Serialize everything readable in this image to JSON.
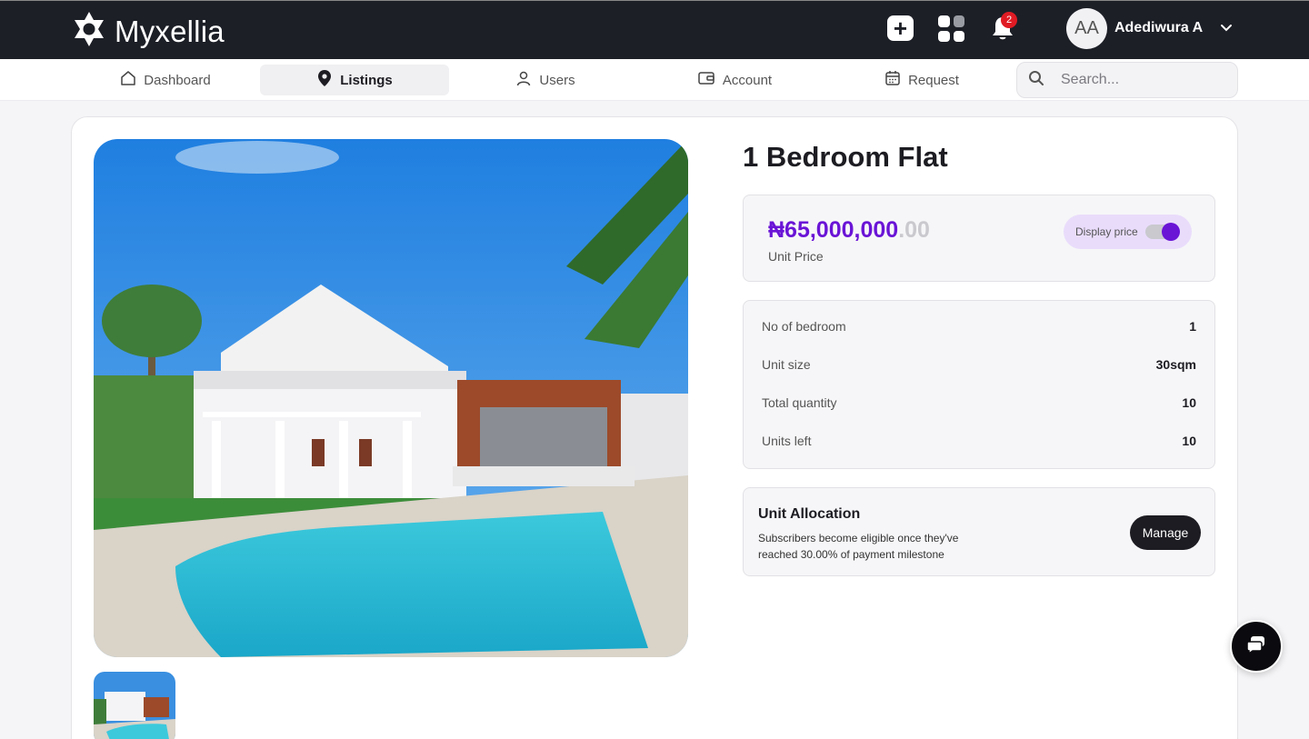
{
  "app": {
    "name": "Myxellia",
    "logo_icon": "star-logo-icon"
  },
  "topbar": {
    "notifications_count": "2",
    "user": {
      "initials": "AA",
      "name": "Adediwura A"
    }
  },
  "nav": {
    "items": [
      {
        "label": "Dashboard",
        "icon": "home-icon"
      },
      {
        "label": "Listings",
        "icon": "location-pin-icon",
        "active": true
      },
      {
        "label": "Users",
        "icon": "user-icon"
      },
      {
        "label": "Account",
        "icon": "wallet-icon"
      },
      {
        "label": "Request",
        "icon": "calendar-icon"
      }
    ],
    "search_placeholder": "Search..."
  },
  "listing": {
    "title": "1 Bedroom Flat",
    "price_main": "₦65,000,000",
    "price_decimal": ".00",
    "price_label": "Unit Price",
    "display_price_label": "Display price",
    "display_price_on": true,
    "details": [
      {
        "label": "No of bedroom",
        "value": "1"
      },
      {
        "label": "Unit size",
        "value": "30sqm"
      },
      {
        "label": "Total quantity",
        "value": "10"
      },
      {
        "label": "Units left",
        "value": "10"
      }
    ],
    "allocation": {
      "title": "Unit Allocation",
      "description": "Subscribers become eligible once they've reached 30.00% of payment milestone",
      "button": "Manage"
    }
  },
  "colors": {
    "accent": "#6a14d6",
    "topbar": "#1d1f27",
    "badge": "#e01b24"
  }
}
